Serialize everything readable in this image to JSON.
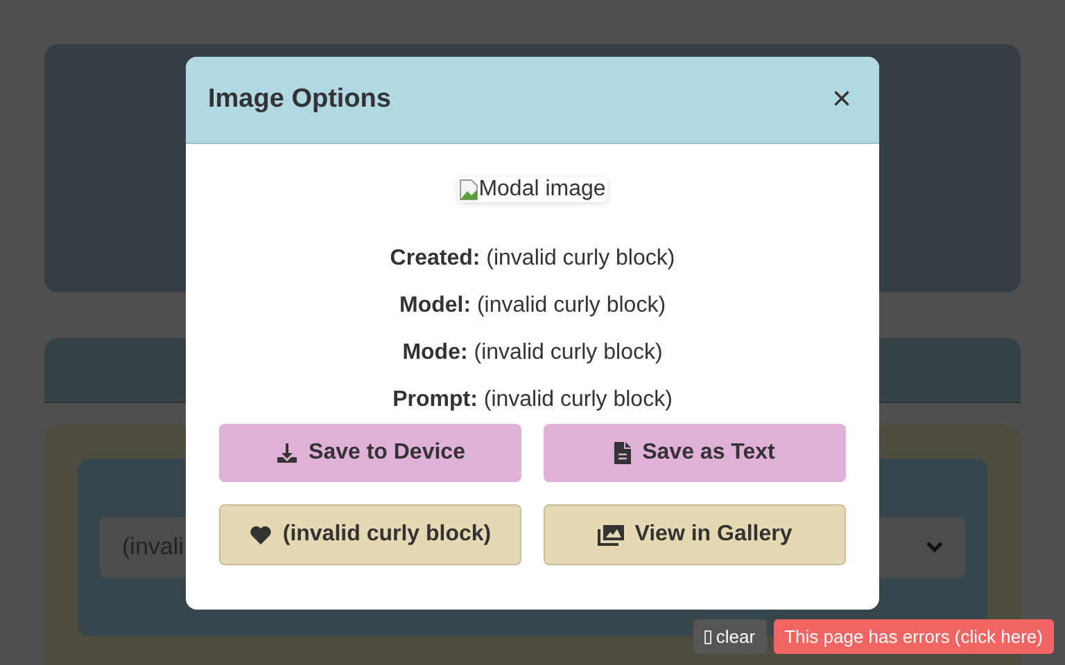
{
  "background": {
    "select_value": "(invali"
  },
  "modal": {
    "title": "Image Options",
    "close": "×",
    "image_alt": "Modal image",
    "details": [
      {
        "label": "Created:",
        "value": "(invalid curly block)"
      },
      {
        "label": "Model:",
        "value": "(invalid curly block)"
      },
      {
        "label": "Mode:",
        "value": "(invalid curly block)"
      },
      {
        "label": "Prompt:",
        "value": "(invalid curly block)"
      }
    ],
    "buttons": [
      {
        "label": "Save to Device",
        "kind": "download"
      },
      {
        "label": "Save as Text",
        "kind": "file"
      },
      {
        "label": "(invalid curly block)",
        "kind": "heart"
      },
      {
        "label": "View in Gallery",
        "kind": "images"
      }
    ]
  },
  "debug": {
    "clear": "clear",
    "errors": "This page has errors (click here)"
  }
}
